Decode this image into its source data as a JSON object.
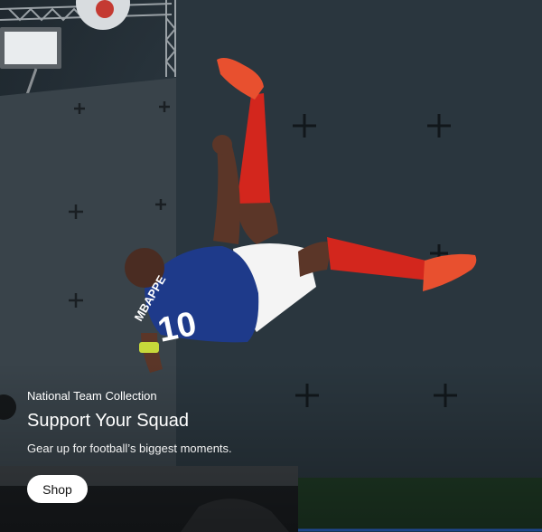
{
  "hero": {
    "eyebrow": "National Team Collection",
    "headline": "Support Your Squad",
    "subtitle": "Gear up for football’s biggest moments.",
    "cta_label": "Shop",
    "jersey_name": "MBAPPE",
    "jersey_number": "10"
  },
  "colors": {
    "wall": "#27323a",
    "jersey": "#1e3a8a",
    "socks": "#d3261d",
    "boots": "#e8502f",
    "shorts": "#f4f4f4",
    "floor": "#1f3a25",
    "button": "#ffffff"
  }
}
